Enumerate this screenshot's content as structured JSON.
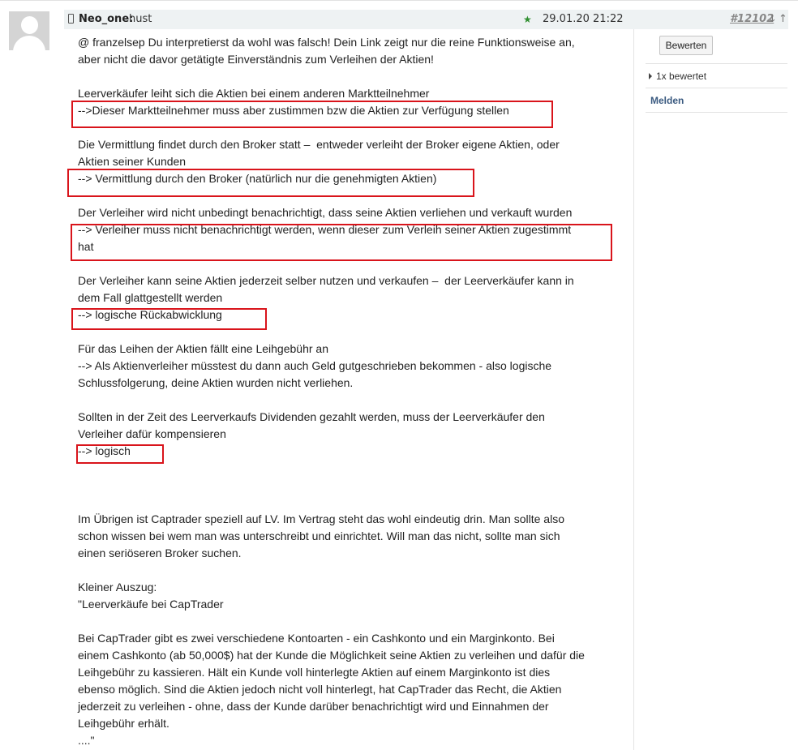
{
  "post": {
    "author": "Neo_one:",
    "title": "hust",
    "date": "29.01.20 21:22",
    "number": "#12102",
    "arrow_down": "↓",
    "arrow_up": "↑"
  },
  "sidebar": {
    "rate_button": "Bewerten",
    "rated": "1x bewertet",
    "report": "Melden"
  },
  "body": [
    "@ franzelsep Du interpretierst da wohl was falsch! Dein Link zeigt nur die reine Funktionsweise an,",
    "aber nicht die davor getätigte Einverständnis zum Verleihen der Aktien!",
    "",
    "Leerverkäufer leiht sich die Aktien bei einem anderen Marktteilnehmer",
    "-->Dieser Marktteilnehmer muss aber zustimmen bzw die Aktien zur Verfügung stellen",
    "",
    "Die Vermittlung findet durch den Broker statt –  entweder verleiht der Broker eigene Aktien, oder",
    "Aktien seiner Kunden",
    "--> Vermittlung durch den Broker (natürlich nur die genehmigten Aktien)",
    "",
    "Der Verleiher wird nicht unbedingt benachrichtigt, dass seine Aktien verliehen und verkauft wurden",
    "--> Verleiher muss nicht benachrichtigt werden, wenn dieser zum Verleih seiner Aktien zugestimmt",
    "hat",
    "",
    "Der Verleiher kann seine Aktien jederzeit selber nutzen und verkaufen –  der Leerverkäufer kann in",
    "dem Fall glattgestellt werden",
    "--> logische Rückabwicklung",
    "",
    "Für das Leihen der Aktien fällt eine Leihgebühr an",
    "--> Als Aktienverleiher müsstest du dann auch Geld gutgeschrieben bekommen - also logische",
    "Schlussfolgerung, deine Aktien wurden nicht verliehen.",
    "",
    "Sollten in der Zeit des Leerverkaufs Dividenden gezahlt werden, muss der Leerverkäufer den",
    "Verleiher dafür kompensieren",
    "--> logisch",
    "",
    "",
    "",
    "Im Übrigen ist Captrader speziell auf LV. Im Vertrag steht das wohl eindeutig drin. Man sollte also",
    "schon wissen bei wem man was unterschreibt und einrichtet. Will man das nicht, sollte man sich",
    "einen seriöseren Broker suchen.",
    "",
    "Kleiner Auszug:",
    "\"Leerverkäufe bei CapTrader",
    "",
    "Bei CapTrader gibt es zwei verschiedene Kontoarten - ein Cashkonto und ein Marginkonto. Bei",
    "einem Cashkonto (ab 50,000$) hat der Kunde die Möglichkeit seine Aktien zu verleihen und dafür die",
    "Leihgebühr zu kassieren. Hält ein Kunde voll hinterlegte Aktien auf einem Marginkonto ist dies",
    "ebenso möglich. Sind die Aktien jedoch nicht voll hinterlegt, hat CapTrader das Recht, die Aktien",
    "jederzeit zu verleihen - ohne, dass der Kunde darüber benachrichtigt wird und Einnahmen der",
    "Leihgebühr erhält.",
    "....\""
  ],
  "colors": {
    "header_bg": "#eef2f3",
    "highlight": "#d9141b",
    "star": "#2f8f2f",
    "report_link": "#3a5a80"
  }
}
